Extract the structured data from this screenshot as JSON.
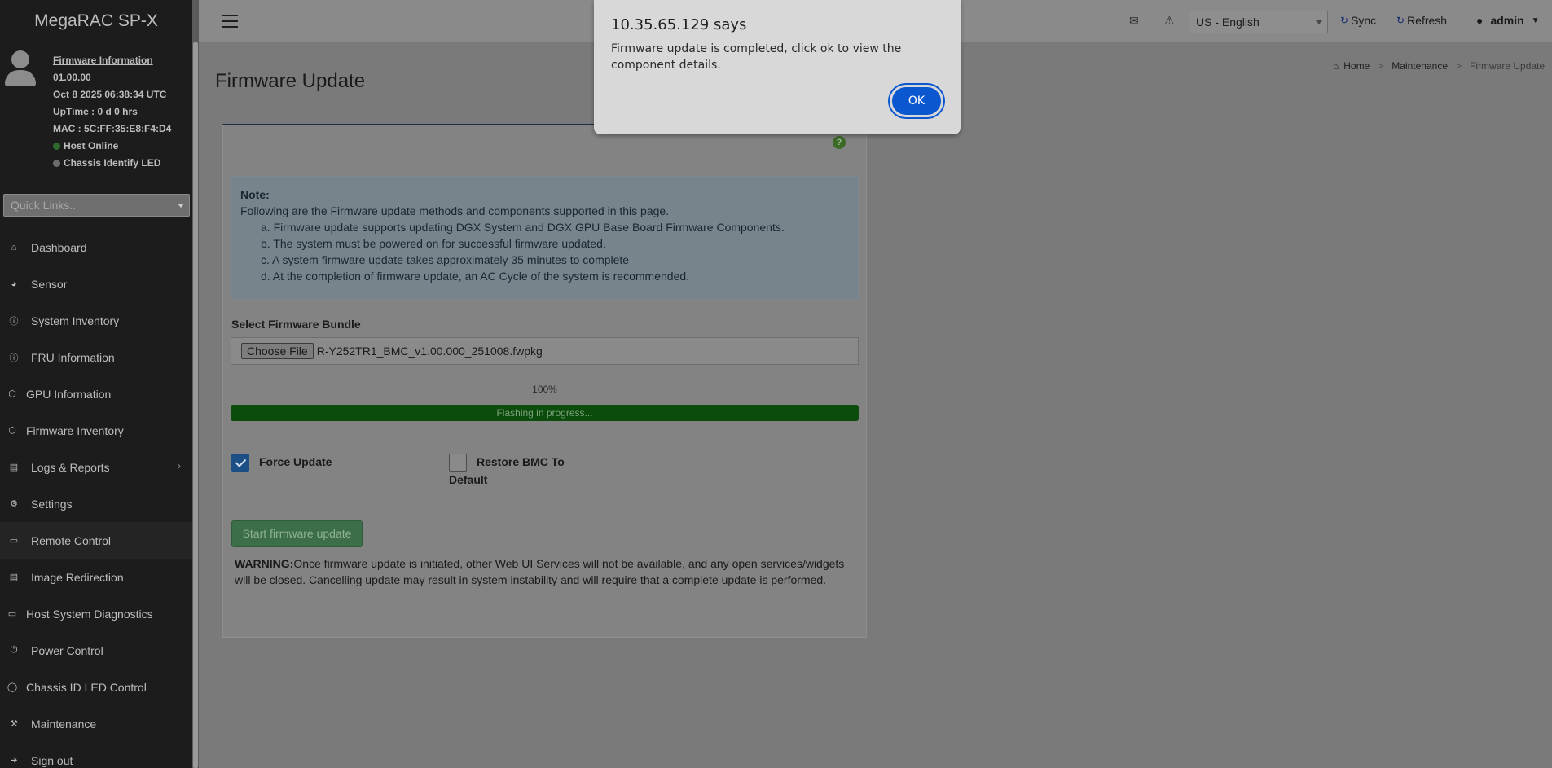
{
  "sidebar": {
    "brand": "MegaRAC SP-X",
    "info": {
      "firmware_link": "Firmware Information",
      "version": "01.00.00",
      "datetime": "Oct 8 2025 06:38:34 UTC",
      "uptime": "UpTime : 0 d 0 hrs",
      "mac": "MAC : 5C:FF:35:E8:F4:D4",
      "host_status": "Host Online",
      "chassis_led": "Chassis Identify LED",
      "host_status_color": "#2f6b2f",
      "chassis_led_color": "#6b6b6b"
    },
    "quick_links_placeholder": "Quick Links..",
    "items": [
      {
        "label": "Dashboard",
        "icon": "home-icon"
      },
      {
        "label": "Sensor",
        "icon": "dashboard-gauge-icon"
      },
      {
        "label": "System Inventory",
        "icon": "info-icon"
      },
      {
        "label": "FRU Information",
        "icon": "info-icon"
      },
      {
        "label": "GPU Information",
        "icon": "cube-icon"
      },
      {
        "label": "Firmware Inventory",
        "icon": "cube-icon"
      },
      {
        "label": "Logs & Reports",
        "icon": "bar-chart-icon"
      },
      {
        "label": "Settings",
        "icon": "gear-icon"
      },
      {
        "label": "Remote Control",
        "icon": "monitor-icon"
      },
      {
        "label": "Image Redirection",
        "icon": "disk-icon"
      },
      {
        "label": "Host System Diagnostics",
        "icon": "monitor-icon"
      },
      {
        "label": "Power Control",
        "icon": "power-icon"
      },
      {
        "label": "Chassis ID LED Control",
        "icon": "lightbulb-icon"
      },
      {
        "label": "Maintenance",
        "icon": "wrench-icon"
      },
      {
        "label": "Sign out",
        "icon": "sign-out-icon"
      }
    ]
  },
  "topbar": {
    "language": "US - English",
    "sync_label": "Sync",
    "refresh_label": "Refresh",
    "user_label": "admin"
  },
  "page": {
    "title": "Firmware Update",
    "breadcrumb": [
      "Home",
      "Maintenance",
      "Firmware Update"
    ]
  },
  "note": {
    "title": "Note:",
    "intro": "Following are the Firmware update methods and components supported in this page.",
    "items": [
      "a. Firmware update supports updating DGX System and DGX GPU Base Board Firmware Components.",
      "b. The system must be powered on for successful firmware updated.",
      "c. A system firmware update takes approximately 35 minutes to complete",
      "d. At the completion of firmware update, an AC Cycle of the system is recommended."
    ]
  },
  "bundle": {
    "label": "Select Firmware Bundle",
    "choose_button": "Choose File",
    "file_name": "R-Y252TR1_BMC_v1.00.000_251008.fwpkg"
  },
  "progress": {
    "percent_text": "100%",
    "value": 1.0,
    "status_text": "Flashing in progress..."
  },
  "options": {
    "force_update_label": "Force Update",
    "force_update_checked": true,
    "restore_label_line1": "Restore BMC To",
    "restore_label_line2": "Default",
    "restore_checked": false
  },
  "actions": {
    "start_button": "Start firmware update",
    "warning_prefix": "WARNING:",
    "warning_text": "Once firmware update is initiated, other Web UI Services will not be available, and any open services/widgets will be closed. Cancelling update may result in system instability and will require that a complete update is performed."
  },
  "dialog": {
    "title": "10.35.65.129 says",
    "message": "Firmware update is completed, click ok to view the component details.",
    "ok_label": "OK"
  }
}
